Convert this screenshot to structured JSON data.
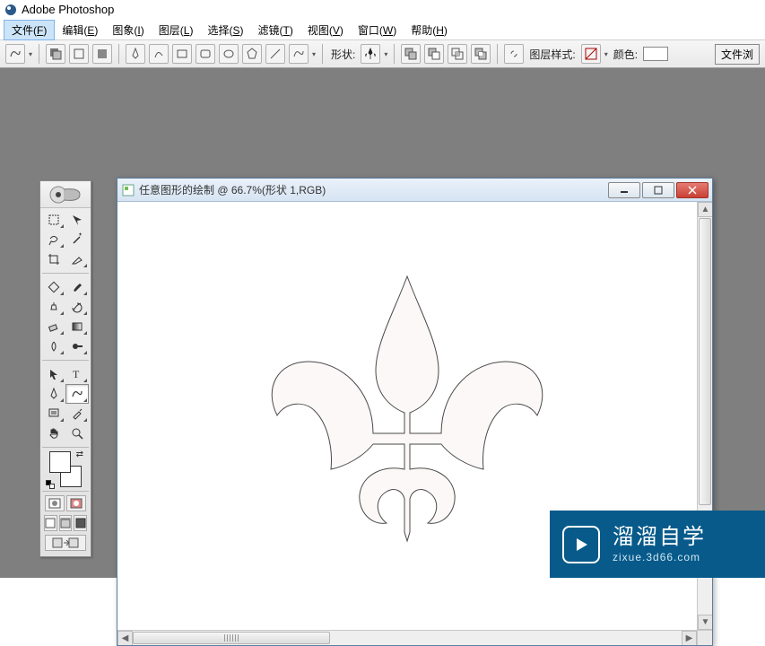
{
  "app": {
    "title": "Adobe Photoshop"
  },
  "menu": {
    "items": [
      {
        "label": "文件",
        "key": "F"
      },
      {
        "label": "编辑",
        "key": "E"
      },
      {
        "label": "图象",
        "key": "I"
      },
      {
        "label": "图层",
        "key": "L"
      },
      {
        "label": "选择",
        "key": "S"
      },
      {
        "label": "滤镜",
        "key": "T"
      },
      {
        "label": "视图",
        "key": "V"
      },
      {
        "label": "窗口",
        "key": "W"
      },
      {
        "label": "帮助",
        "key": "H"
      }
    ],
    "active_index": 0
  },
  "options": {
    "shape_label": "形状:",
    "layer_style_label": "图层样式:",
    "color_label": "颜色:",
    "color_value": "#ffffff",
    "file_browse_label": "文件浏"
  },
  "document": {
    "title": "任意图形的绘制 @ 66.7%(形状 1,RGB)"
  },
  "watermark": {
    "brand": "溜溜自学",
    "domain": "zixue.3d66.com"
  },
  "colors": {
    "workspace_bg": "#7f7f7f",
    "watermark_bg": "#075a8a"
  }
}
